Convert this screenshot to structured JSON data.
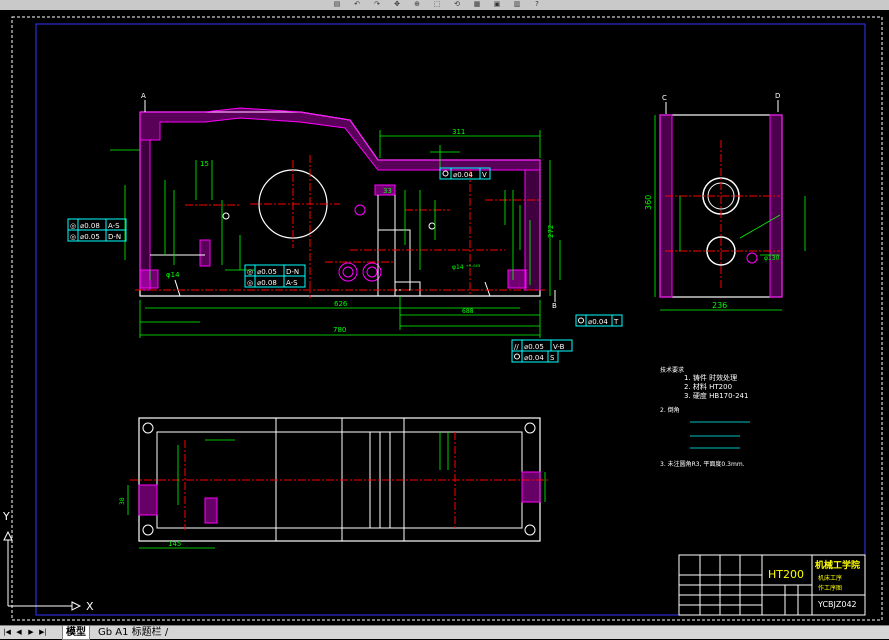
{
  "toolbar": {
    "buttons": [
      "save-icon",
      "undo-icon",
      "redo-icon",
      "pan-icon",
      "zoom-icon",
      "zoom-window-icon",
      "zoom-previous-icon",
      "properties-icon",
      "design-center-icon",
      "tool-palette-icon",
      "help-icon"
    ]
  },
  "drawing": {
    "front_view": {
      "dim_overall": "780",
      "dim_626": "626",
      "dim_311": "311",
      "dim_272": "272",
      "dim_33": "33",
      "dim_15": "15",
      "dim_14": "φ14",
      "dim_bore": "φ14 ⁺⁰·⁰⁴³",
      "dim_688": "688",
      "tol_v": "0.04",
      "tol_v_datum": "V",
      "tol_as_1": "0.08",
      "tol_as_1_datum": "A-S",
      "tol_dn_1": "0.05",
      "tol_dn_1_datum": "D-N",
      "tol_dn_2": "0.05",
      "tol_dn_2_datum": "D-N",
      "tol_as_2": "0.08",
      "tol_as_2_datum": "A-S",
      "tol_t": "0.04",
      "tol_t_datum": "T",
      "tol_vb": "0.05",
      "tol_vb_datum": "V-B",
      "tol_s": "0.04",
      "tol_s_datum": "S",
      "section_a": "A",
      "section_b": "B"
    },
    "side_view": {
      "dim_height": "360",
      "dim_width": "236",
      "dim_bore": "φ130",
      "section_c": "C",
      "section_d": "D"
    },
    "plan_view": {
      "dim_145": "145",
      "dim_38": "38"
    },
    "notes": {
      "title": "技术要求",
      "items": [
        "1. 铸件 时效处理",
        "2. 材料 HT200",
        "3. 硬度 HB170-241"
      ],
      "item_hb": "HB170-241",
      "item_ht": "HT200",
      "section2": "2. 倒角",
      "section3": "3. 未注圆角R3, 平面度0.3mm."
    },
    "title_block": {
      "material": "HT200",
      "org": "机械工学院",
      "part_name": "机床工序",
      "part_name2": "作工序图",
      "drawing_no": "YCBJZ042"
    }
  },
  "ucs": {
    "x_label": "X",
    "y_label": "Y"
  },
  "tabs": [
    "模型",
    "Gb A1 标题栏 /"
  ],
  "active_tab": 0,
  "colors": {
    "magenta": "#ff00ff",
    "green": "#00ff00",
    "cyan": "#00ffff",
    "red": "#ff0000",
    "white": "#ffffff",
    "yellow": "#ffff00",
    "blue": "#0000ff"
  }
}
